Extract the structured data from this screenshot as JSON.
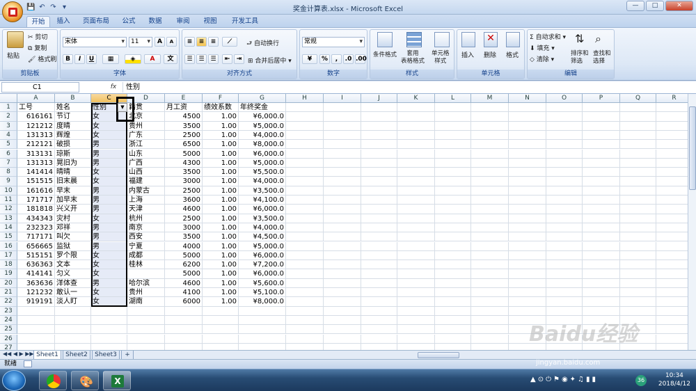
{
  "window": {
    "title": "奖金计算表.xlsx - Microsoft Excel",
    "buttons": {
      "minimize": "—",
      "maximize": "□",
      "close": "✕"
    }
  },
  "qat": {
    "save": "💾",
    "undo": "↶",
    "redo": "↷",
    "more": "▾"
  },
  "ribbon_tabs": [
    {
      "label": "开始",
      "active": true
    },
    {
      "label": "插入"
    },
    {
      "label": "页面布局"
    },
    {
      "label": "公式"
    },
    {
      "label": "数据"
    },
    {
      "label": "审阅"
    },
    {
      "label": "视图"
    },
    {
      "label": "开发工具"
    }
  ],
  "ribbon": {
    "clipboard": {
      "group": "剪贴板",
      "paste": "粘贴",
      "cut": "剪切",
      "copy": "复制",
      "format_painter": "格式刷"
    },
    "font": {
      "group": "字体",
      "name": "宋体",
      "size": "11",
      "bold": "B",
      "italic": "I",
      "underline": "U",
      "grow": "A",
      "shrink": "A"
    },
    "alignment": {
      "group": "对齐方式",
      "wrap": "自动换行",
      "merge": "合并后居中"
    },
    "number": {
      "group": "数字",
      "format": "常规",
      "percent": "%",
      "comma": ","
    },
    "styles": {
      "group": "样式",
      "conditional": "条件格式",
      "table": "套用\n表格格式",
      "cell": "单元格\n样式"
    },
    "cells": {
      "group": "单元格",
      "insert": "插入",
      "delete": "删除",
      "format": "格式"
    },
    "editing": {
      "group": "编辑",
      "autosum": "自动求和",
      "fill": "填充",
      "clear": "清除",
      "sort": "排序和\n筛选",
      "find": "查找和\n选择"
    }
  },
  "formula_bar": {
    "name_box": "C1",
    "fx": "fx",
    "value": "性别"
  },
  "columns": [
    "A",
    "B",
    "C",
    "D",
    "E",
    "F",
    "G",
    "H",
    "I",
    "J",
    "K",
    "L",
    "M",
    "N",
    "O",
    "P",
    "Q",
    "R"
  ],
  "rows": [
    "1",
    "2",
    "3",
    "4",
    "5",
    "6",
    "7",
    "8",
    "9",
    "10",
    "11",
    "12",
    "13",
    "14",
    "15",
    "16",
    "17",
    "18",
    "19",
    "20",
    "21",
    "22",
    "23",
    "24",
    "25",
    "26",
    "27"
  ],
  "table": {
    "headers": [
      "工号",
      "姓名",
      "性别",
      "籍贯",
      "月工资",
      "绩效系数",
      "年终奖金"
    ],
    "records": [
      [
        "616161",
        "节订",
        "女",
        "北京",
        "4500",
        "1.00",
        "¥6,000.0"
      ],
      [
        "121212",
        "度晴",
        "女",
        "贵州",
        "3500",
        "1.00",
        "¥5,000.0"
      ],
      [
        "131313",
        "辉煌",
        "女",
        "广东",
        "2500",
        "1.00",
        "¥4,000.0"
      ],
      [
        "212121",
        "破损",
        "男",
        "浙江",
        "6500",
        "1.00",
        "¥8,000.0"
      ],
      [
        "313131",
        "琼斯",
        "男",
        "山东",
        "5000",
        "1.00",
        "¥6,000.0"
      ],
      [
        "131313",
        "晃旧为",
        "男",
        "广西",
        "4300",
        "1.00",
        "¥5,000.0"
      ],
      [
        "141414",
        "晴晴",
        "女",
        "山西",
        "3500",
        "1.00",
        "¥5,500.0"
      ],
      [
        "151515",
        "旧末晨",
        "女",
        "福建",
        "3000",
        "1.00",
        "¥4,000.0"
      ],
      [
        "161616",
        "早末",
        "男",
        "内蒙古",
        "2500",
        "1.00",
        "¥3,500.0"
      ],
      [
        "171717",
        "加早末",
        "男",
        "上海",
        "3600",
        "1.00",
        "¥4,100.0"
      ],
      [
        "181818",
        "兴义开",
        "男",
        "天津",
        "4600",
        "1.00",
        "¥6,000.0"
      ],
      [
        "434343",
        "灾村",
        "女",
        "杭州",
        "2500",
        "1.00",
        "¥3,500.0"
      ],
      [
        "232323",
        "邓祥",
        "男",
        "南京",
        "3000",
        "1.00",
        "¥4,000.0"
      ],
      [
        "717171",
        "叫欠",
        "男",
        "西安",
        "3500",
        "1.00",
        "¥4,500.0"
      ],
      [
        "656665",
        "监狱",
        "男",
        "宁夏",
        "4000",
        "1.00",
        "¥5,000.0"
      ],
      [
        "515151",
        "罗个限",
        "女",
        "成都",
        "5000",
        "1.00",
        "¥6,000.0"
      ],
      [
        "636363",
        "文本",
        "女",
        "桂林",
        "6200",
        "1.00",
        "¥7,200.0"
      ],
      [
        "414141",
        "匀义",
        "女",
        "",
        "5000",
        "1.00",
        "¥6,000.0"
      ],
      [
        "363636",
        "洋体查",
        "男",
        "哈尔滨",
        "4600",
        "1.00",
        "¥5,600.0"
      ],
      [
        "121232",
        "敢认一",
        "女",
        "贵州",
        "4100",
        "1.00",
        "¥5,100.0"
      ],
      [
        "919191",
        "淡人盯",
        "女",
        "湖南",
        "6000",
        "1.00",
        "¥8,000.0"
      ]
    ]
  },
  "sheets": [
    "Sheet1",
    "Sheet2",
    "Sheet3"
  ],
  "status": {
    "ready": "就绪"
  },
  "taskbar": {
    "time": "10:34",
    "date": "2018/4/12",
    "badge": "36"
  },
  "watermark": {
    "text": "Baidu经验",
    "url": "jingyan.baidu.com"
  }
}
